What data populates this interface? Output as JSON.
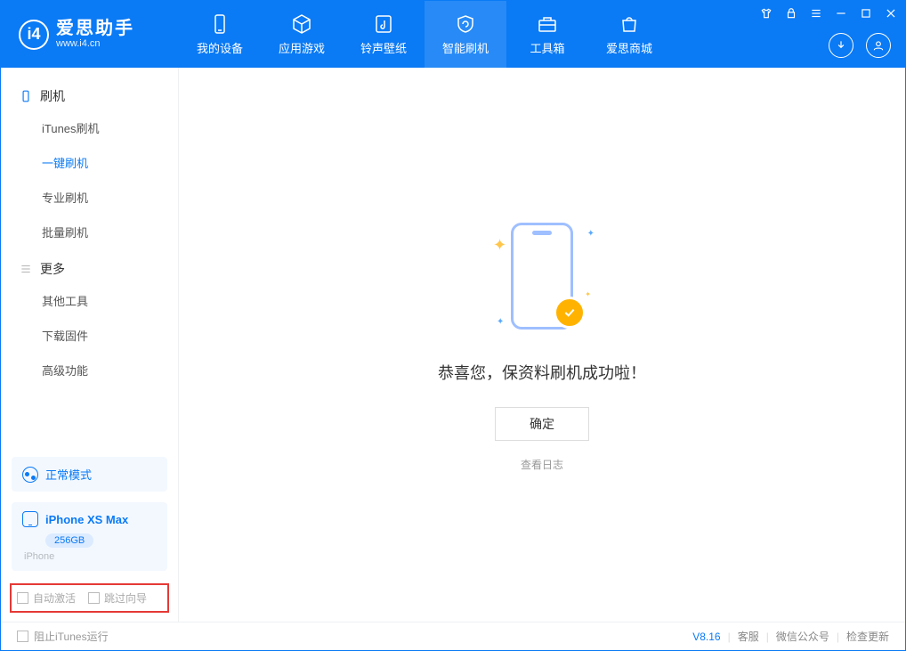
{
  "app": {
    "name_cn": "爱思助手",
    "name_en": "www.i4.cn"
  },
  "nav": {
    "items": [
      {
        "label": "我的设备"
      },
      {
        "label": "应用游戏"
      },
      {
        "label": "铃声壁纸"
      },
      {
        "label": "智能刷机"
      },
      {
        "label": "工具箱"
      },
      {
        "label": "爱思商城"
      }
    ]
  },
  "sidebar": {
    "group_flash": "刷机",
    "group_more": "更多",
    "flash_items": [
      {
        "label": "iTunes刷机"
      },
      {
        "label": "一键刷机"
      },
      {
        "label": "专业刷机"
      },
      {
        "label": "批量刷机"
      }
    ],
    "more_items": [
      {
        "label": "其他工具"
      },
      {
        "label": "下载固件"
      },
      {
        "label": "高级功能"
      }
    ],
    "mode_label": "正常模式",
    "device": {
      "name": "iPhone XS Max",
      "capacity": "256GB",
      "type": "iPhone"
    },
    "opts": {
      "auto_activate": "自动激活",
      "skip_guide": "跳过向导"
    }
  },
  "main": {
    "success_msg": "恭喜您，保资料刷机成功啦！",
    "ok_label": "确定",
    "log_link": "查看日志"
  },
  "status": {
    "block_itunes": "阻止iTunes运行",
    "version": "V8.16",
    "links": [
      {
        "label": "客服"
      },
      {
        "label": "微信公众号"
      },
      {
        "label": "检查更新"
      }
    ]
  }
}
